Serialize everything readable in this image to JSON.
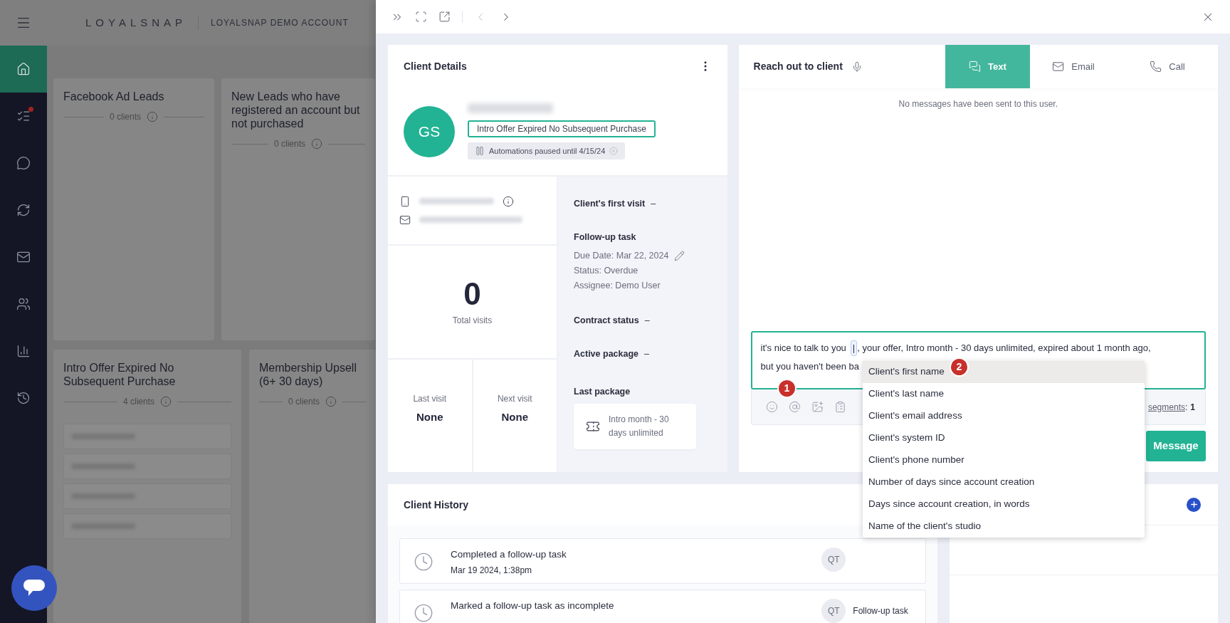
{
  "app_header": {
    "logo": "LOYALSNAP",
    "account": "LOYALSNAP DEMO ACCOUNT"
  },
  "sidebar": {
    "items": [
      {
        "selected": true,
        "notification": false
      },
      {
        "selected": false,
        "notification": true
      },
      {
        "selected": false,
        "notification": false
      },
      {
        "selected": false,
        "notification": false
      },
      {
        "selected": false,
        "notification": false
      },
      {
        "selected": false,
        "notification": false
      },
      {
        "selected": false,
        "notification": false
      },
      {
        "selected": false,
        "notification": false
      }
    ]
  },
  "segments": [
    {
      "title": "Facebook Ad Leads",
      "count": "0 clients"
    },
    {
      "title": "New Leads who have registered an account but not purchased",
      "count": "0 clients"
    },
    {
      "title": "Intro Offer Expired No Subsequent Purchase",
      "count": "4 clients",
      "client_rows": [
        {
          "kind": "blurred"
        },
        {
          "kind": "blurred"
        },
        {
          "kind": "blurred"
        },
        {
          "kind": "blurred"
        }
      ]
    },
    {
      "title": "Membership Upsell (6+ 30 days)",
      "count": "0 clients"
    }
  ],
  "client_details": {
    "title": "Client Details",
    "initials": "GS",
    "tag": "Intro Offer Expired No Subsequent Purchase",
    "automation_chip": "Automations paused until 4/15/24",
    "total_visits": {
      "value": "0",
      "label": "Total visits"
    },
    "visits": [
      {
        "label": "Last visit",
        "value": "None"
      },
      {
        "label": "Next visit",
        "value": "None"
      }
    ],
    "details": [
      {
        "kind": "field",
        "label": "Client's first visit",
        "value": "–"
      },
      {
        "kind": "task",
        "label": "Follow-up task",
        "lines": [
          "Due Date: Mar 22, 2024",
          "Status: Overdue",
          "Assignee: Demo User"
        ]
      },
      {
        "kind": "field",
        "label": "Contract status",
        "value": "–"
      },
      {
        "kind": "field",
        "label": "Active package",
        "value": "–"
      },
      {
        "kind": "package",
        "label": "Last package",
        "package": "Intro month - 30 days unlimited"
      }
    ]
  },
  "reach_out": {
    "title": "Reach out to client",
    "tabs": [
      {
        "label": "Text",
        "selected": true
      },
      {
        "label": "Email",
        "selected": false
      },
      {
        "label": "Call",
        "selected": false
      }
    ],
    "empty_message": "No messages have been sent to this user.",
    "composer": {
      "text_before_token": "it's nice to talk to you",
      "token": "|",
      "text_after_token": ", your offer, Intro month - 30 days unlimited, expired about 1 month ago,",
      "line_2": "but you haven't been ba"
    },
    "segments_link": "segments",
    "segments_separator": ":",
    "segments_count": "1",
    "send_button": "Message"
  },
  "variable_menu": {
    "items": [
      {
        "label": "Client's first name",
        "selected": true
      },
      {
        "label": "Client's last name",
        "selected": false
      },
      {
        "label": "Client's email address",
        "selected": false
      },
      {
        "label": "Client's system ID",
        "selected": false
      },
      {
        "label": "Client's phone number",
        "selected": false
      },
      {
        "label": "Number of days since account creation",
        "selected": false
      },
      {
        "label": "Days since account creation, in words",
        "selected": false
      },
      {
        "label": "Name of the client's studio",
        "selected": false
      }
    ]
  },
  "annotations": [
    {
      "number": "1"
    },
    {
      "number": "2"
    }
  ],
  "history": {
    "title": "Client History",
    "entries": [
      {
        "title": "Completed a follow-up task",
        "date": "Mar 19 2024, 1:38pm",
        "initials": "QT"
      },
      {
        "title": "Marked a follow-up task as incomplete",
        "initials": "QT",
        "tag": "Follow-up task"
      }
    ]
  }
}
